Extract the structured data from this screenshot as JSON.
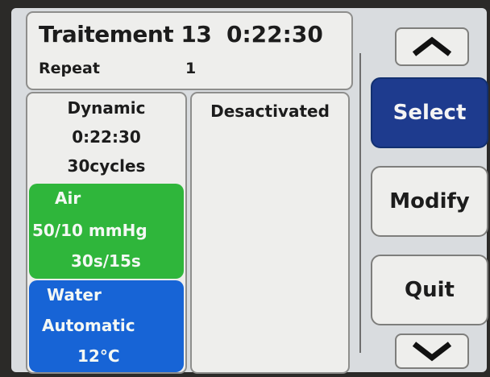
{
  "header": {
    "title": "Traitement 13",
    "time": "0:22:30",
    "repeat_label": "Repeat",
    "repeat_value": "1"
  },
  "program": {
    "mode": "Dynamic",
    "duration": "0:22:30",
    "cycles": "30cycles",
    "air": {
      "label": "Air",
      "pressure": "50/10 mmHg",
      "timing": "30s/15s",
      "color": "#2fb63b"
    },
    "water": {
      "label": "Water",
      "mode": "Automatic",
      "temperature": "12°C",
      "color": "#1764d6"
    }
  },
  "secondary": {
    "status": "Desactivated"
  },
  "buttons": {
    "up_icon": "chevron-up-icon",
    "select": "Select",
    "modify": "Modify",
    "quit": "Quit",
    "down_icon": "chevron-down-icon"
  },
  "colors": {
    "select_active": "#1e3b8e",
    "panel_bg": "#eeeeec"
  }
}
